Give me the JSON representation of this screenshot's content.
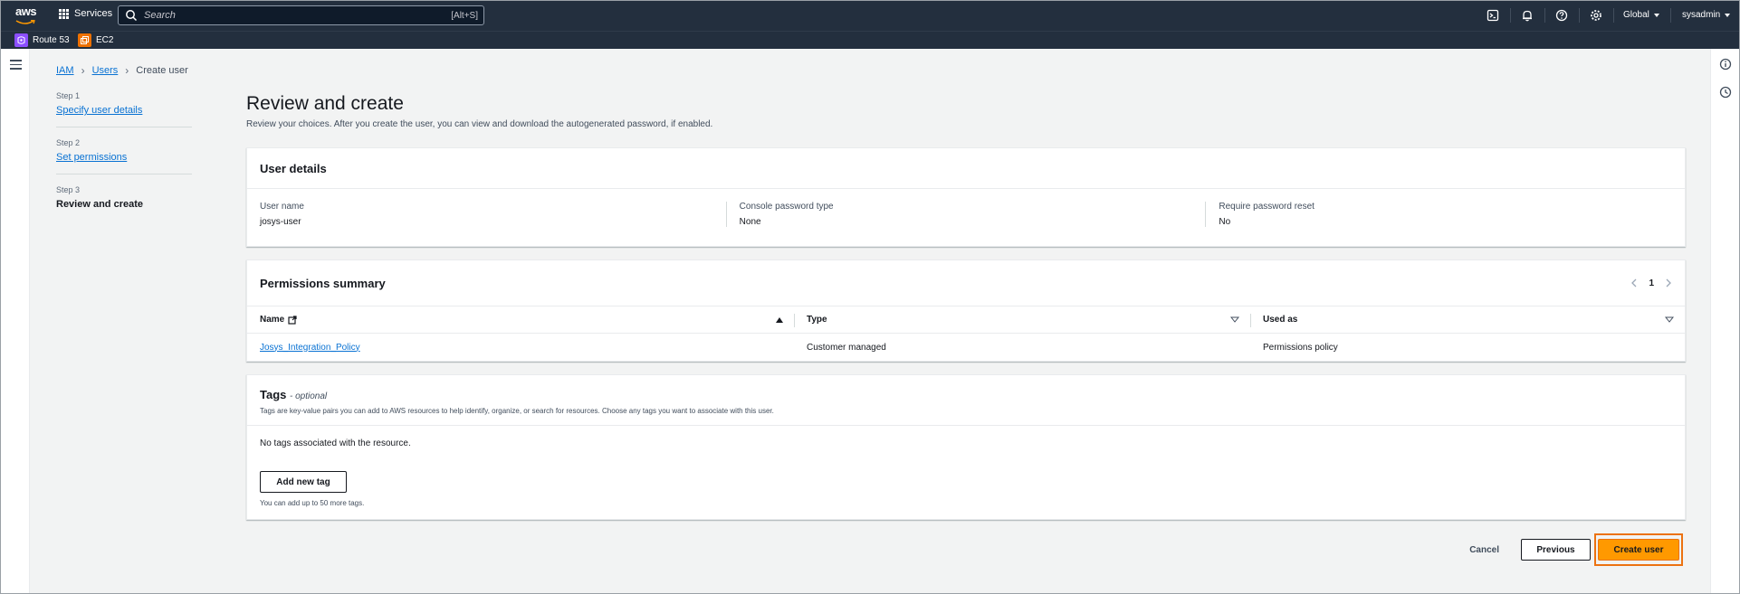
{
  "topnav": {
    "logo_text": "aws",
    "services_label": "Services",
    "search_placeholder": "Search",
    "search_shortcut": "[Alt+S]",
    "region_label": "Global",
    "account_label": "sysadmin"
  },
  "favorites": [
    {
      "label": "Route 53",
      "icon": "route53-icon",
      "color": "#8c4fff"
    },
    {
      "label": "EC2",
      "icon": "ec2-icon",
      "color": "#ed7100"
    }
  ],
  "breadcrumb": [
    {
      "label": "IAM",
      "link": true
    },
    {
      "label": "Users",
      "link": true
    },
    {
      "label": "Create user",
      "link": false
    }
  ],
  "steps": [
    {
      "num": "Step 1",
      "label": "Specify user details",
      "current": false
    },
    {
      "num": "Step 2",
      "label": "Set permissions",
      "current": false
    },
    {
      "num": "Step 3",
      "label": "Review and create",
      "current": true
    }
  ],
  "page": {
    "title": "Review and create",
    "description": "Review your choices. After you create the user, you can view and download the autogenerated password, if enabled."
  },
  "user_details": {
    "header": "User details",
    "fields": [
      {
        "label": "User name",
        "value": "josys-user"
      },
      {
        "label": "Console password type",
        "value": "None"
      },
      {
        "label": "Require password reset",
        "value": "No"
      }
    ]
  },
  "permissions": {
    "header": "Permissions summary",
    "page_number": "1",
    "columns": [
      "Name",
      "Type",
      "Used as"
    ],
    "rows": [
      {
        "name": "Josys_Integration_Policy",
        "type": "Customer managed",
        "used_as": "Permissions policy"
      }
    ]
  },
  "tags": {
    "title": "Tags",
    "optional": "- optional",
    "description": "Tags are key-value pairs you can add to AWS resources to help identify, organize, or search for resources. Choose any tags you want to associate with this user.",
    "empty_text": "No tags associated with the resource.",
    "add_button": "Add new tag",
    "hint": "You can add up to 50 more tags."
  },
  "footer": {
    "cancel": "Cancel",
    "previous": "Previous",
    "create": "Create user"
  },
  "colors": {
    "nav_bg": "#232f3e",
    "link": "#0972d3",
    "primary_button": "#ff9900",
    "highlight_border": "#ec7211"
  }
}
